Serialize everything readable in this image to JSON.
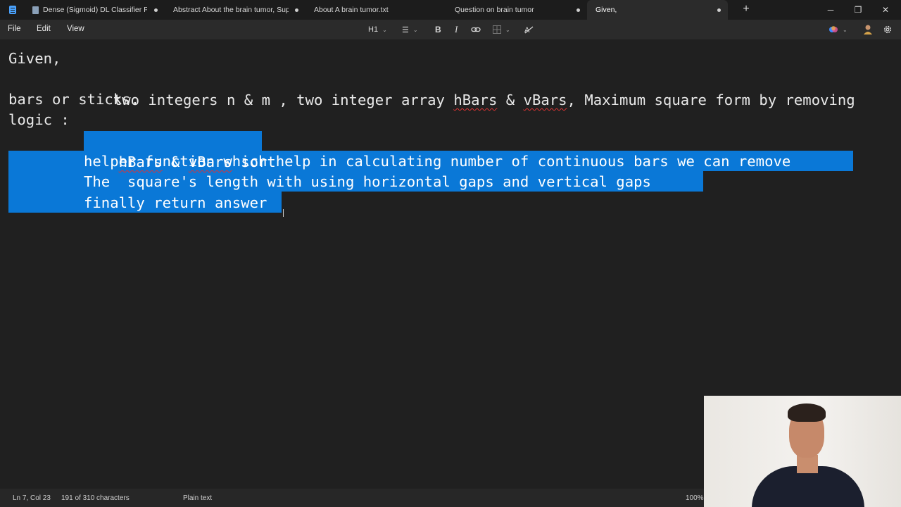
{
  "tabs": [
    {
      "label": "Dense (Sigmoid) DL Classifier Pe",
      "modified": true
    },
    {
      "label": "Abstract About the brain tumor, Sup",
      "modified": true
    },
    {
      "label": "About A brain tumor.txt",
      "modified": false
    },
    {
      "label": "Question on brain tumor",
      "modified": true
    },
    {
      "label": "Given,",
      "modified": true,
      "active": true
    }
  ],
  "new_tab_label": "+",
  "window_controls": {
    "minimize": "─",
    "maximize": "❐",
    "close": "✕"
  },
  "menu": {
    "file": "File",
    "edit": "Edit",
    "view": "View"
  },
  "toolbar": {
    "heading": "H1",
    "list": "☰",
    "bold": "B",
    "italic": "I",
    "link": "🔗",
    "table": "⊞",
    "clear_format": "A̶",
    "chevron": "⌄"
  },
  "document": {
    "lines": [
      "Given,",
      "        two integers n & m , two integer array hBars & vBars, Maximum square form by removing",
      "bars or sticks.",
      "logic :",
      "hBars & vBars sort ",
      "helper function which help in calculating number of continuous bars we can remove ",
      "The  square's length with using horizontal gaps and vertical gaps ",
      "finally return answer"
    ],
    "line2_parts": {
      "a": "        two integers n & m , two integer array ",
      "b": "hBars",
      "c": " & ",
      "d": "vBars",
      "e": ", Maximum square form by removing"
    },
    "line5_parts": {
      "a": "hBars",
      "b": " & ",
      "c": "vBars",
      "d": " sort "
    }
  },
  "status": {
    "position": "Ln 7, Col 23",
    "characters": "191 of 310 characters",
    "format": "Plain text",
    "zoom": "100%"
  },
  "colors": {
    "accent": "#0a78d7",
    "background": "#202020",
    "spellcheck": "#d33333"
  }
}
